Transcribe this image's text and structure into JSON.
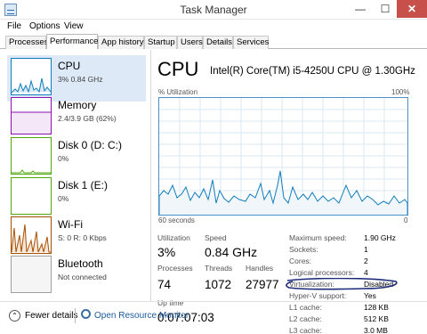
{
  "window": {
    "title": "Task Manager",
    "minimize": "—",
    "maximize": "☐",
    "close": "✕"
  },
  "menu": [
    "File",
    "Options",
    "View"
  ],
  "tabs": [
    "Processes",
    "Performance",
    "App history",
    "Startup",
    "Users",
    "Details",
    "Services"
  ],
  "active_tab": "Performance",
  "sidebar": [
    {
      "name": "CPU",
      "sub": "3% 0.84 GHz",
      "color": "#117dbb"
    },
    {
      "name": "Memory",
      "sub": "2.4/3.9 GB (62%)",
      "color": "#8b12ae"
    },
    {
      "name": "Disk 0 (D: C:)",
      "sub": "0%",
      "color": "#4da60c"
    },
    {
      "name": "Disk 1 (E:)",
      "sub": "0%",
      "color": "#4da60c"
    },
    {
      "name": "Wi-Fi",
      "sub": "S: 0 R: 0 Kbps",
      "color": "#a74f01"
    },
    {
      "name": "Bluetooth",
      "sub": "Not connected",
      "color": "#a0a0a0"
    }
  ],
  "main": {
    "title": "CPU",
    "model": "Intel(R) Core(TM) i5-4250U CPU @ 1.30GHz",
    "util_label": "% Utilization",
    "max_label": "100%",
    "time_label": "60 seconds",
    "zero_label": "0"
  },
  "stats": {
    "utilization": {
      "label": "Utilization",
      "value": "3%"
    },
    "speed": {
      "label": "Speed",
      "value": "0.84 GHz"
    },
    "processes": {
      "label": "Processes",
      "value": "74"
    },
    "threads": {
      "label": "Threads",
      "value": "1072"
    },
    "handles": {
      "label": "Handles",
      "value": "27977"
    },
    "uptime": {
      "label": "Up time",
      "value": "0:07:07:03"
    }
  },
  "specs": [
    {
      "k": "Maximum speed:",
      "v": "1.90 GHz"
    },
    {
      "k": "Sockets:",
      "v": "1"
    },
    {
      "k": "Cores:",
      "v": "2"
    },
    {
      "k": "Logical processors:",
      "v": "4"
    },
    {
      "k": "Virtualization:",
      "v": "Disabled"
    },
    {
      "k": "Hyper-V support:",
      "v": "Yes"
    },
    {
      "k": "L1 cache:",
      "v": "128 KB"
    },
    {
      "k": "L2 cache:",
      "v": "512 KB"
    },
    {
      "k": "L3 cache:",
      "v": "3.0 MB"
    }
  ],
  "footer": {
    "fewer": "Fewer details",
    "resource": "Open Resource Monitor"
  },
  "colors": {
    "cpu_line": "#117dbb",
    "cpu_fill": "#f1f6fa",
    "grid": "#d9eaf4",
    "annotation_ink": "#1c2a7a"
  }
}
